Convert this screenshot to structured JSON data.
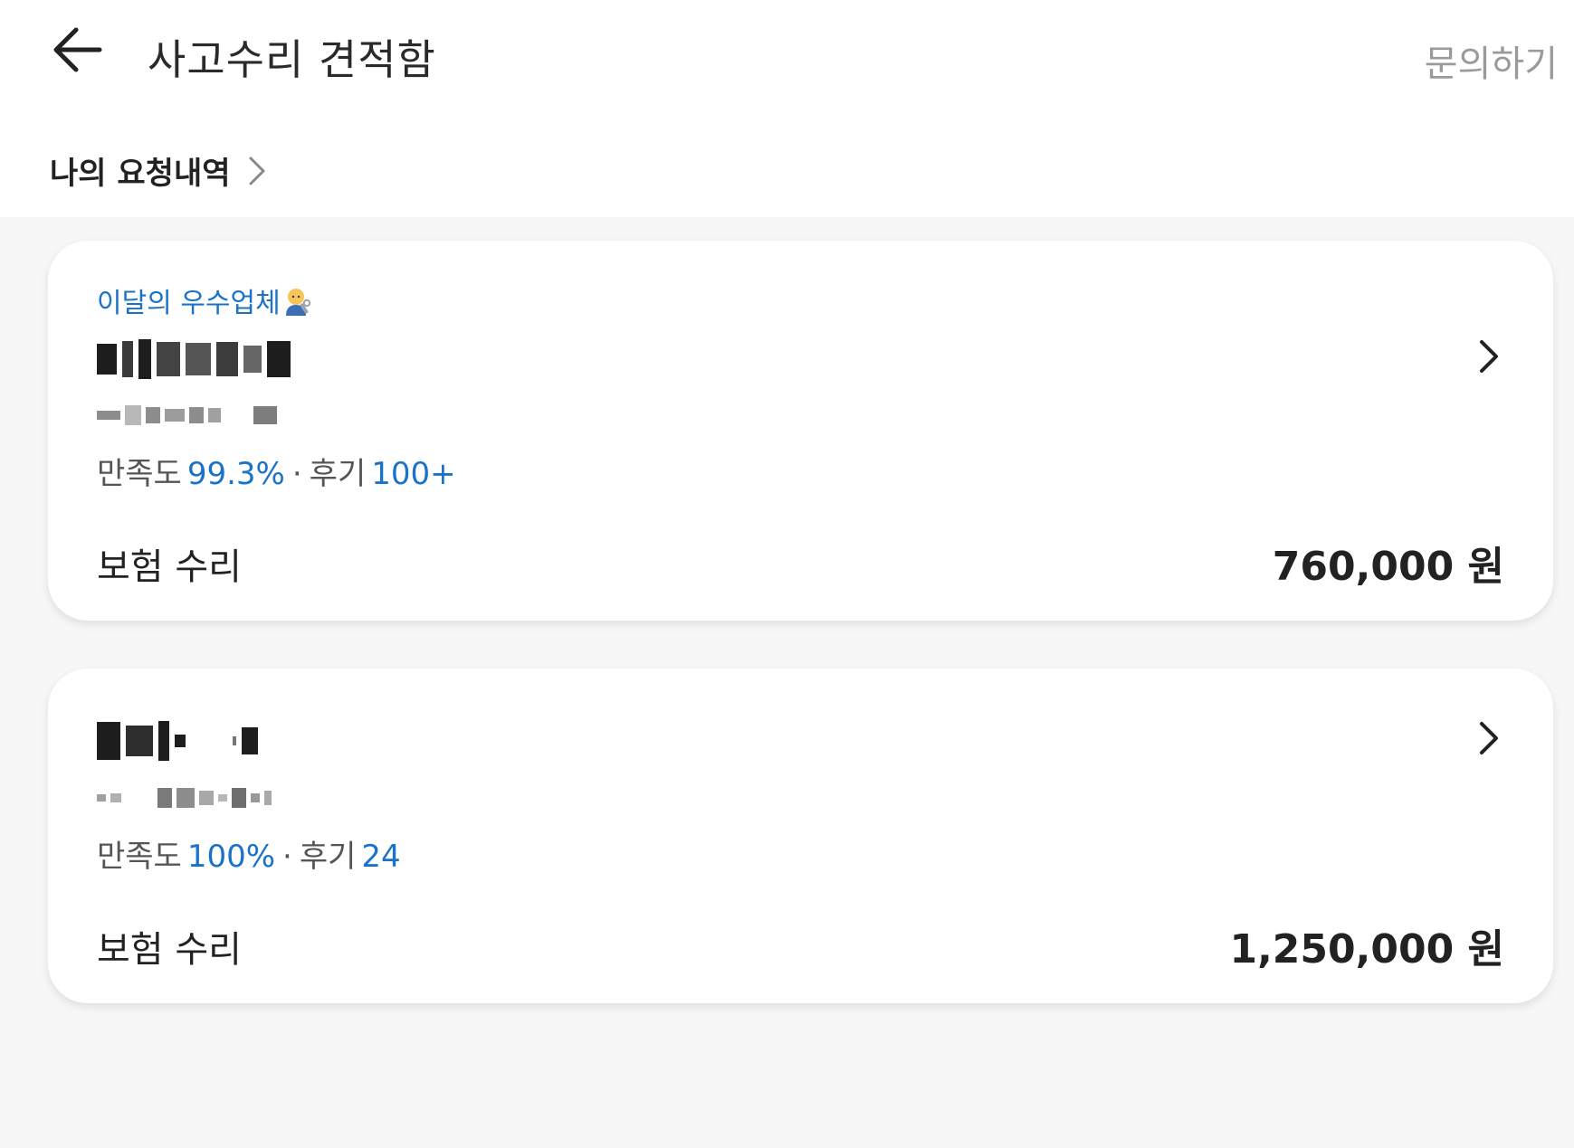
{
  "header": {
    "title": "사고수리 견적함",
    "inquiry_label": "문의하기"
  },
  "my_requests": {
    "label": "나의 요청내역"
  },
  "colors": {
    "accent": "#1a73c9",
    "text": "#222222",
    "muted": "#9a9a9a",
    "background": "#f7f7f7"
  },
  "cards": [
    {
      "badge": "이달의 우수업체",
      "badge_icon": "mechanic-emoji-icon",
      "satisfaction_label": "만족도",
      "satisfaction_value": "99.3%",
      "reviews_label": "후기",
      "reviews_value": "100+",
      "service": "보험 수리",
      "price": "760,000 원"
    },
    {
      "satisfaction_label": "만족도",
      "satisfaction_value": "100%",
      "reviews_label": "후기",
      "reviews_value": "24",
      "service": "보험 수리",
      "price": "1,250,000 원"
    }
  ],
  "separator": "·"
}
